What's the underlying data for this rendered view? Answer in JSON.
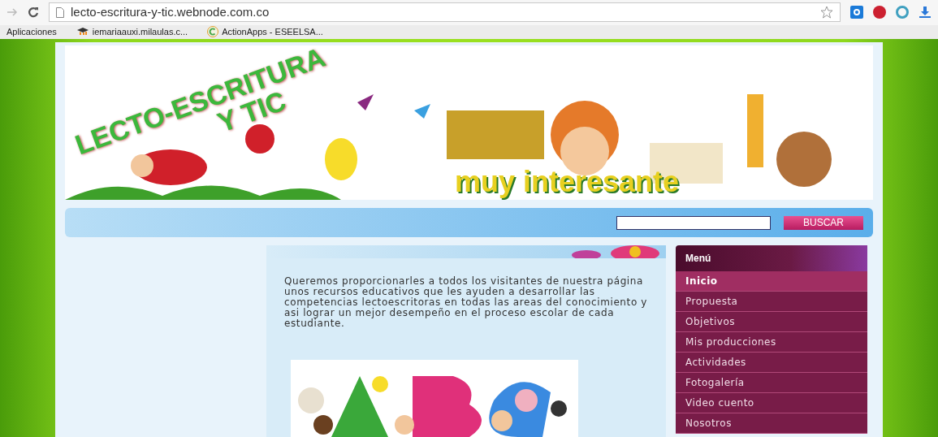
{
  "browser": {
    "url": "lecto-escritura-y-tic.webnode.com.co",
    "bookmarks": [
      {
        "label": "Aplicaciones",
        "kind": "apps"
      },
      {
        "label": "iemariaauxi.milaulas.c...",
        "kind": "moodle"
      },
      {
        "label": "ActionApps - ESEELSA...",
        "kind": "site"
      }
    ]
  },
  "banner": {
    "title": [
      "LECTO-ESCRITURA",
      "Y TIC"
    ],
    "slogan": "muy interesante"
  },
  "search": {
    "button": "BUSCAR"
  },
  "content": {
    "paragraph": "Queremos proporcionarles a todos los visitantes de nuestra página unos recursos educativos que les ayuden a desarrollar las competencias lectoescritoras en todas las areas del conocimiento y asi lograr un mejor desempeño en el proceso escolar de cada estudiante."
  },
  "menu": {
    "title": "Menú",
    "items": [
      {
        "label": "Inicio",
        "selected": true
      },
      {
        "label": "Propuesta",
        "selected": false
      },
      {
        "label": "Objetivos",
        "selected": false
      },
      {
        "label": "Mis producciones",
        "selected": false
      },
      {
        "label": "Actividades",
        "selected": false
      },
      {
        "label": "Fotogalería",
        "selected": false
      },
      {
        "label": "Video cuento",
        "selected": false
      },
      {
        "label": "Nosotros",
        "selected": false
      }
    ]
  }
}
